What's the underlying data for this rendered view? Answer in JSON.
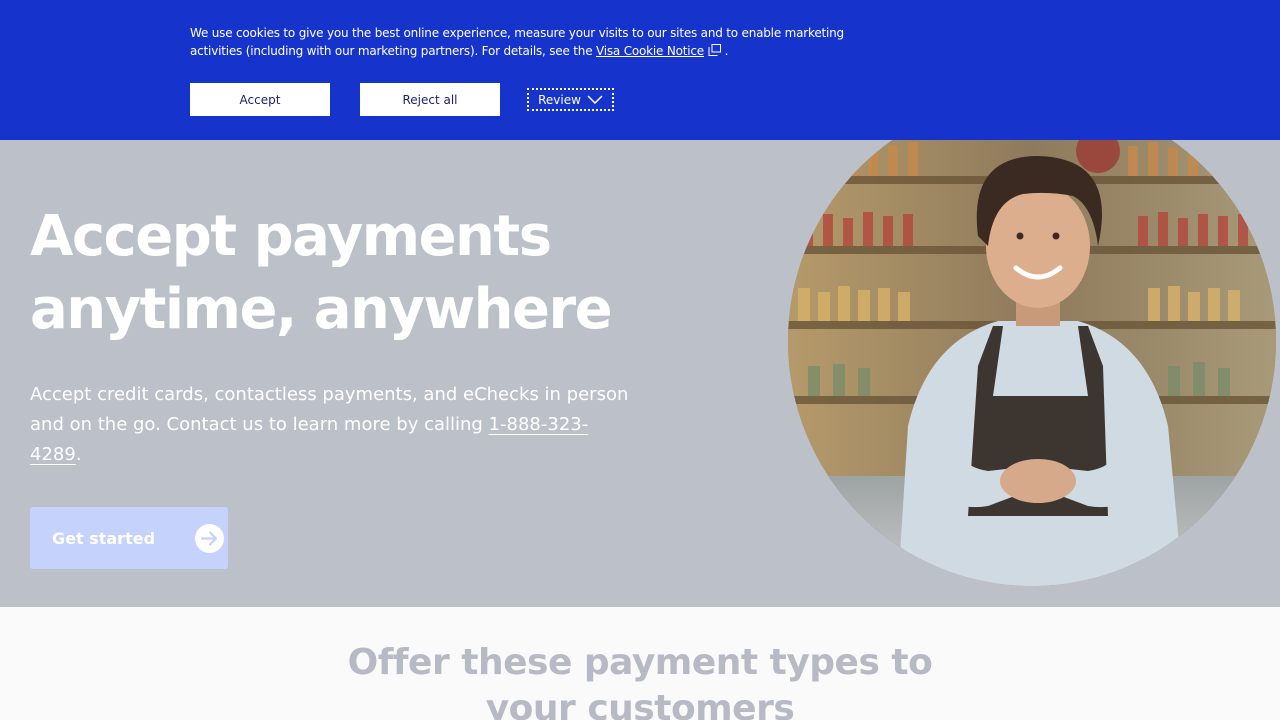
{
  "cookie_banner": {
    "text_before": "We use cookies to give you the best online experience, measure your visits to our sites and to enable marketing activities (including with our marketing partners). For details, see the ",
    "link_label": "Visa Cookie Notice",
    "text_after": " .",
    "accept_label": "Accept",
    "reject_label": "Reject all",
    "review_label": "Review",
    "colors": {
      "background": "#1634cc",
      "button_text": "#1a1f71"
    }
  },
  "hero": {
    "title": "Accept payments anytime, anywhere",
    "subtitle_before": "Accept credit cards, contactless payments, and eChecks in person and on the go. Contact us to learn more by calling ",
    "phone": "1-888-323-4289",
    "subtitle_after": ".",
    "cta_label": "Get started",
    "cta_icon": "arrow-right-circle-icon",
    "photo": "smiling-merchant-photo",
    "colors": {
      "background": "#bcc0c9",
      "cta": "#c5d2fb"
    }
  },
  "section": {
    "title": "Offer these payment types to your customers"
  }
}
